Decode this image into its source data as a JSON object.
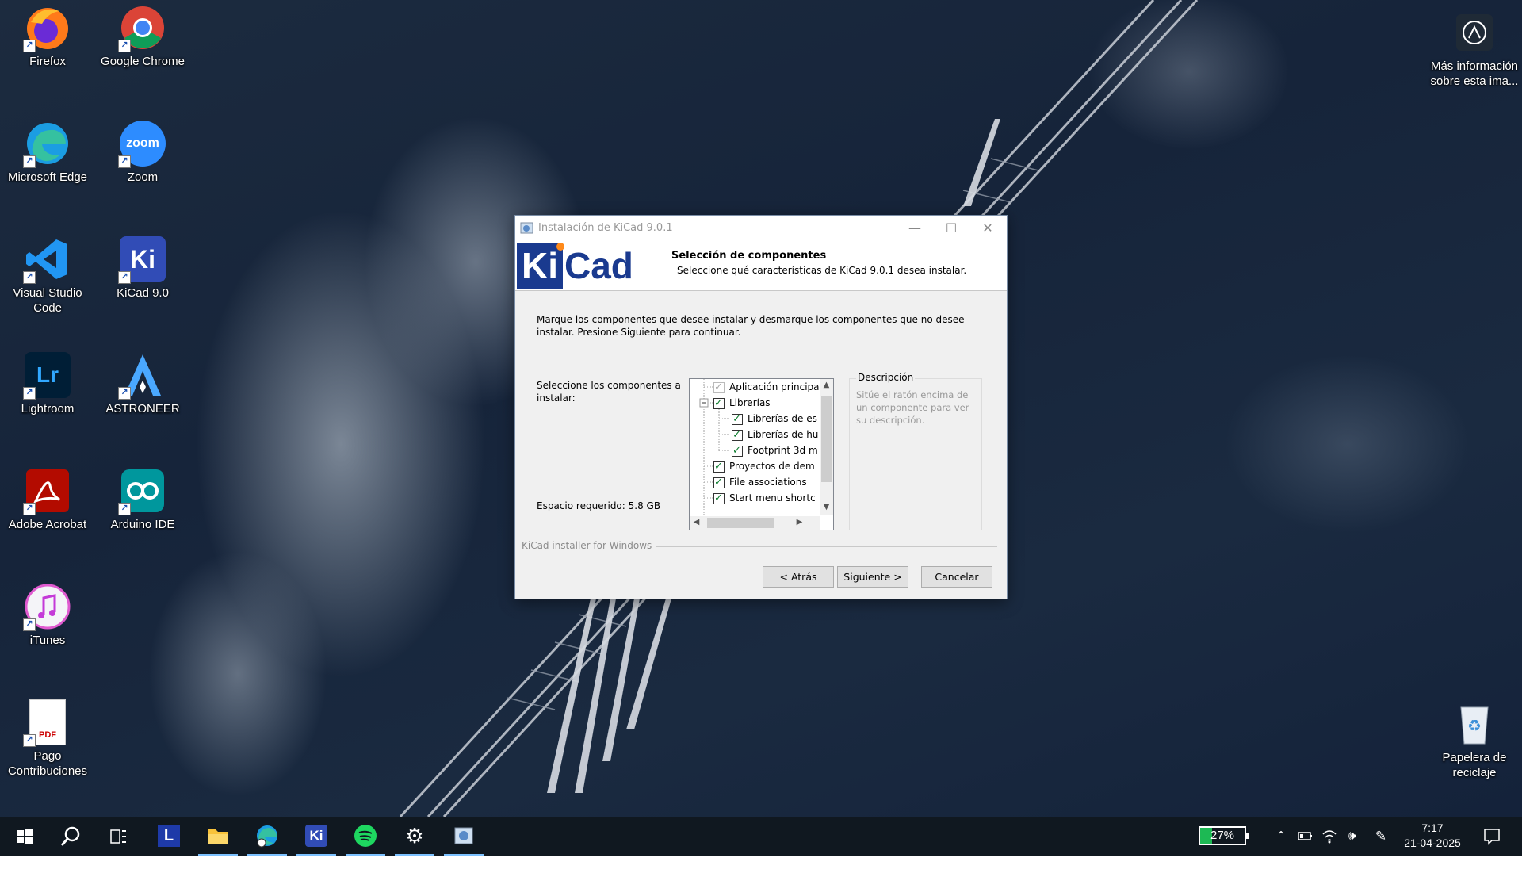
{
  "desktop": {
    "icons": [
      {
        "label": "Firefox"
      },
      {
        "label": "Google Chrome"
      },
      {
        "label": "Microsoft Edge"
      },
      {
        "label": "Zoom"
      },
      {
        "label": "Visual Studio Code"
      },
      {
        "label": "KiCad 9.0"
      },
      {
        "label": "Lightroom"
      },
      {
        "label": "ASTRONEER"
      },
      {
        "label": "Adobe Acrobat"
      },
      {
        "label": "Arduino IDE"
      },
      {
        "label": "iTunes"
      },
      {
        "label": "Pago Contribuciones"
      },
      {
        "label": "Más información sobre esta ima..."
      },
      {
        "label": "Papelera de reciclaje"
      }
    ],
    "icon_glyphs": {
      "zoom": "zoom",
      "kicad": "Ki",
      "lightroom": "Lr",
      "pdf": "PDF"
    }
  },
  "dialog": {
    "title": "Instalación de KiCad 9.0.1",
    "logo_text_ki": "Ki",
    "logo_text_cad": "Cad",
    "header_title": "Selección de componentes",
    "header_subtitle": "Seleccione qué características de KiCad 9.0.1 desea instalar.",
    "intro": "Marque los componentes que desee instalar y desmarque los componentes que no desee instalar. Presione Siguiente para continuar.",
    "select_label": "Seleccione los componentes a instalar:",
    "space_required": "Espacio requerido: 5.8 GB",
    "tree_items": [
      {
        "label": "Aplicación principa",
        "checked": true,
        "disabled": true,
        "level": 0
      },
      {
        "label": "Librerías",
        "checked": true,
        "disabled": false,
        "level": 0
      },
      {
        "label": "Librerías de es",
        "checked": true,
        "disabled": false,
        "level": 1
      },
      {
        "label": "Librerías de hu",
        "checked": true,
        "disabled": false,
        "level": 1
      },
      {
        "label": "Footprint 3d m",
        "checked": true,
        "disabled": false,
        "level": 1
      },
      {
        "label": "Proyectos de dem",
        "checked": true,
        "disabled": false,
        "level": 0
      },
      {
        "label": "File associations",
        "checked": true,
        "disabled": false,
        "level": 0
      },
      {
        "label": "Start menu shortc",
        "checked": true,
        "disabled": false,
        "level": 0
      }
    ],
    "description_title": "Descripción",
    "description_text": "Sitúe el ratón encima de un componente para ver su descripción.",
    "footer_label": "KiCad installer for Windows",
    "buttons": {
      "back": "< Atrás",
      "next": "Siguiente >",
      "cancel": "Cancelar"
    }
  },
  "taskbar": {
    "apps": [
      "start",
      "search",
      "task-view",
      "lightroom-l",
      "file-explorer",
      "edge",
      "kicad",
      "spotify",
      "settings",
      "installer"
    ],
    "kicad_glyph": "Ki",
    "lightroom_glyph": "L",
    "battery": "27%",
    "time": "7:17",
    "date": "21-04-2025"
  },
  "colors": {
    "accent": "#0078d7",
    "kicad_blue": "#1a3a8f",
    "taskbar": "#101820"
  }
}
